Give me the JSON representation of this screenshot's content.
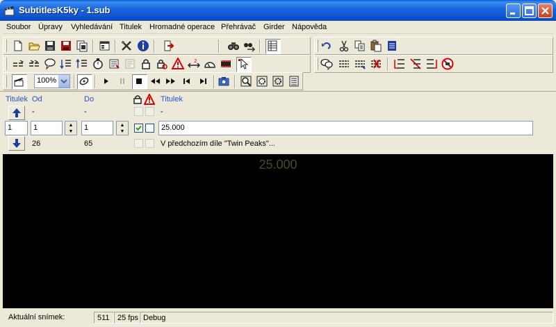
{
  "window": {
    "title": "SubtitlesK5ky - 1.sub",
    "buttons": [
      "minimize",
      "maximize",
      "close"
    ]
  },
  "menu": [
    "Soubor",
    "Úpravy",
    "Vyhledávání",
    "Titulek",
    "Hromadné operace",
    "Přehrávač",
    "Girder",
    "Nápověda"
  ],
  "toolbar": {
    "row1": [
      "new-file-icon",
      "open-folder-icon",
      "save-icon",
      "save-as-icon",
      "copy-file-icon",
      "properties-icon",
      "tools-icon",
      "info-icon",
      "exit-icon",
      "find-icon",
      "find-next-icon",
      "grid-view-icon",
      "undo-icon",
      "cut-icon",
      "copy-icon",
      "paste-icon",
      "document-icon"
    ],
    "row2": [
      "shift-icon",
      "shift-all-icon",
      "speech-icon",
      "merge-icon",
      "split-icon",
      "stopwatch-icon",
      "sync-icon",
      "sync-disabled-icon",
      "lock-icon",
      "lock-search-icon",
      "warning-icon",
      "stretch-icon",
      "gauge-icon",
      "film-icon",
      "pointer-icon",
      "speech-bubbles-icon",
      "lines-icon",
      "lines-edit-icon",
      "lines-delete-icon",
      "insert-before-icon",
      "delete-row-icon",
      "insert-after-icon",
      "no-entry-icon"
    ],
    "row3": [
      "clapper-icon",
      "zoom-select",
      "eject-icon",
      "play-icon",
      "pause-icon",
      "stop-icon",
      "rewind-icon",
      "fast-forward-icon",
      "prev-frame-icon",
      "next-frame-icon",
      "camera-icon",
      "zoom-frame-icon",
      "settings-frame-icon",
      "settings-frame2-icon",
      "list-frame-icon"
    ],
    "zoom_value": "100%"
  },
  "editor": {
    "headers": {
      "titulek": "Titulek",
      "od": "Od",
      "do": "Do",
      "text": "Titulek"
    },
    "prev_row": {
      "od": "-",
      "do": "-",
      "text": "-"
    },
    "current_row": {
      "index": "1",
      "od": "1",
      "do": "1",
      "text": "25.000",
      "lock_checked": true,
      "warning_checked": false
    },
    "next_row": {
      "od": "26",
      "do": "65",
      "text": "V předchozím díle \"Twin Peaks\"..."
    }
  },
  "video": {
    "subtitle_text": "25.000",
    "subtitle_color": "#4F4A1F",
    "background": "#000000"
  },
  "status": {
    "label": "Aktuální snímek:",
    "frame": "511",
    "fps": "25 fps",
    "mode": "Debug"
  }
}
